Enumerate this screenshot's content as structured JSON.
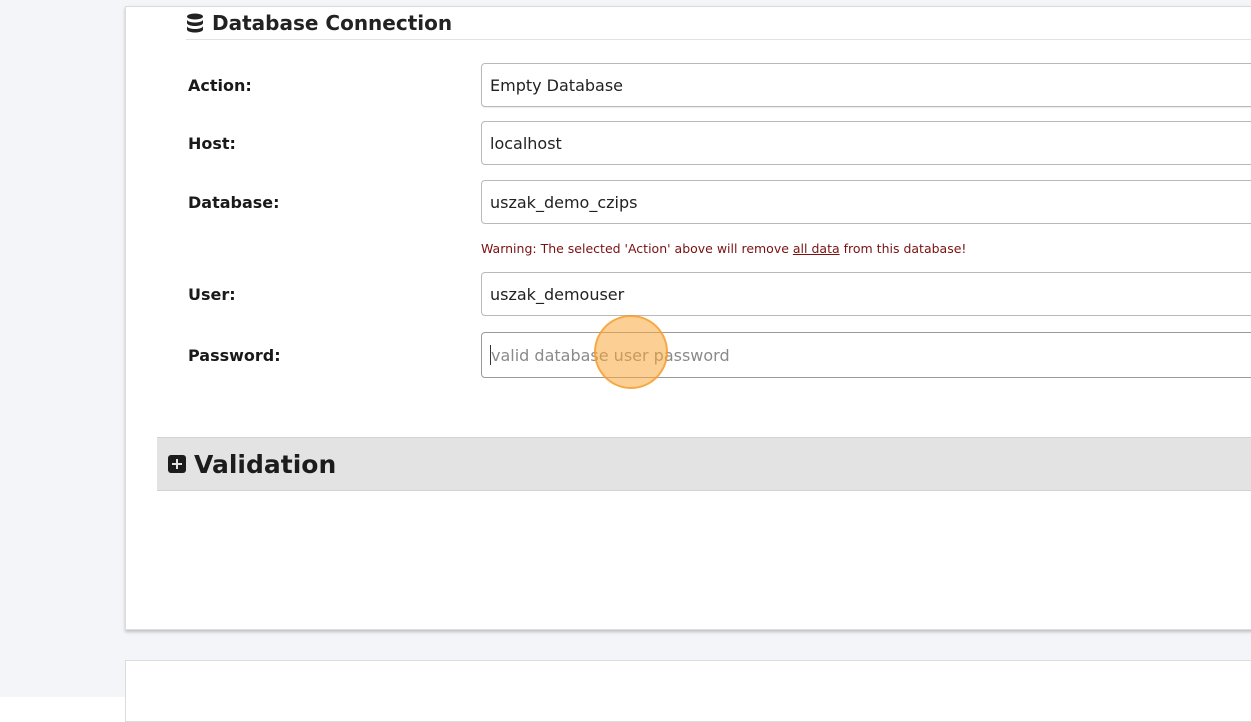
{
  "section": {
    "title": "Database Connection",
    "icon": "database-icon"
  },
  "form": {
    "action": {
      "label": "Action:",
      "value": "Empty Database"
    },
    "host": {
      "label": "Host:",
      "value": "localhost"
    },
    "database": {
      "label": "Database:",
      "value": "uszak_demo_czips"
    },
    "warning": {
      "prefix": "Warning: The selected 'Action' above will remove ",
      "emphasis": "all data",
      "suffix": " from this database!"
    },
    "user": {
      "label": "User:",
      "value": "uszak_demouser"
    },
    "password": {
      "label": "Password:",
      "value": "",
      "placeholder": "valid database user password"
    }
  },
  "validation": {
    "title": "Validation",
    "icon": "plus-square-icon"
  },
  "colors": {
    "warning": "#7a1111",
    "click_indicator": "#f7a93c",
    "section_bar": "#e3e3e3"
  }
}
